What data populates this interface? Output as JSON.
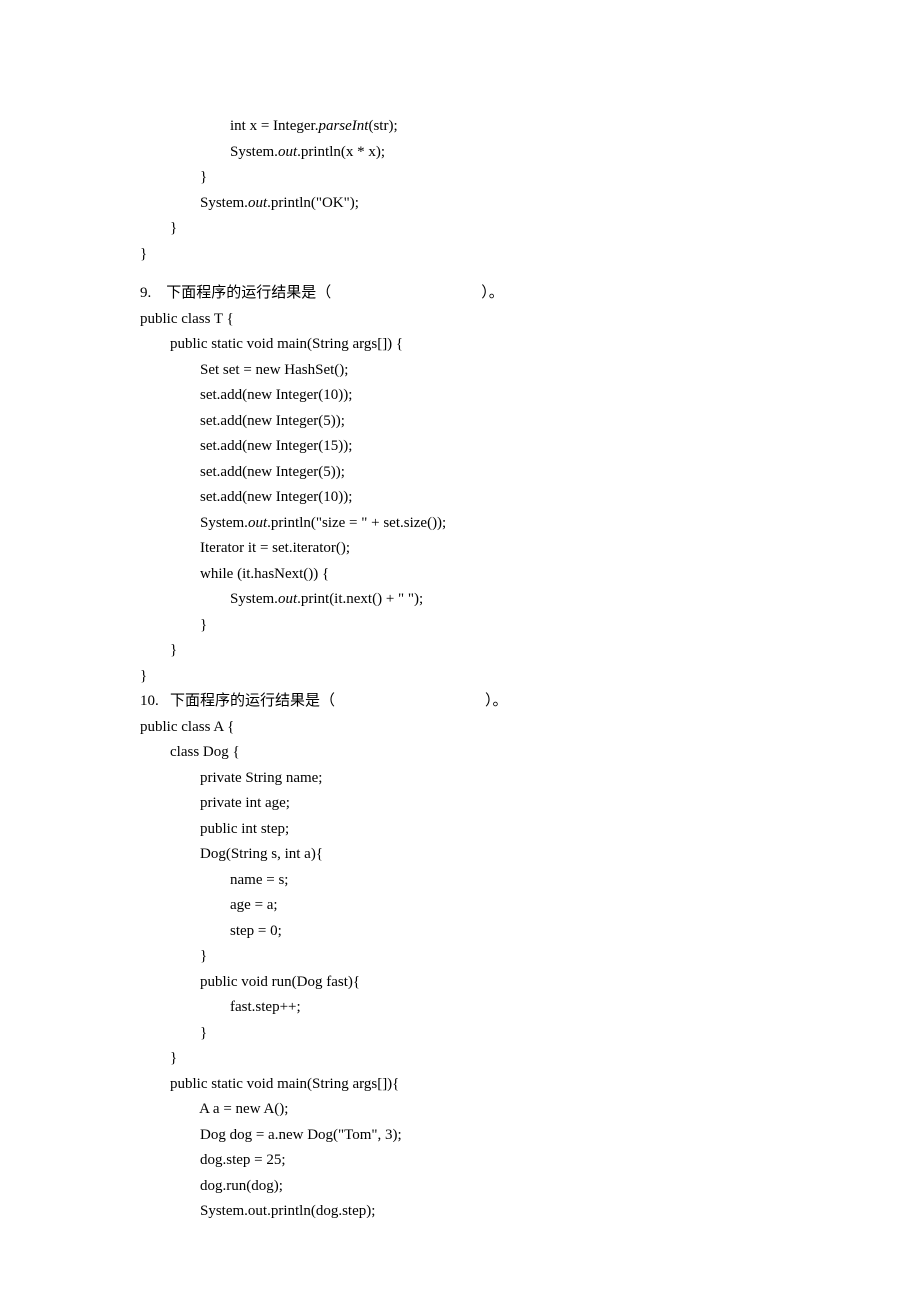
{
  "pre_code": {
    "l1": "                        int x = Integer.",
    "l1_i": "parseInt",
    "l1b": "(str);",
    "l2": "                        System.",
    "l2_i": "out",
    "l2b": ".println(x * x);",
    "l3": "                }",
    "l4": "                System.",
    "l4_i": "out",
    "l4b": ".println(\"OK\");",
    "l5": "        }",
    "l6": "}"
  },
  "q9": {
    "num": "9.",
    "text_a": "下面程序的运行结果是（",
    "text_b": "）。",
    "c1": "public class T {",
    "c2": "        public static void main(String args[]) {",
    "c3": "                Set set = new HashSet();",
    "c4": "                set.add(new Integer(10));",
    "c5": "                set.add(new Integer(5));",
    "c6": "                set.add(new Integer(15));",
    "c7": "                set.add(new Integer(5));",
    "c8": "                set.add(new Integer(10));",
    "c9a": "                System.",
    "c9i": "out",
    "c9b": ".println(\"size = \" + set.size());",
    "c10": "                Iterator it = set.iterator();",
    "c11": "                while (it.hasNext()) {",
    "c12a": "                        System.",
    "c12i": "out",
    "c12b": ".print(it.next() + \" \");",
    "c13": "                }",
    "c14": "        }",
    "c15": "}"
  },
  "q10": {
    "num": "10.",
    "text_a": "下面程序的运行结果是（",
    "text_b": "）。",
    "c1": "public class A {",
    "c2": "        class Dog {",
    "c3": "                private String name;",
    "c4": "                private int age;",
    "c5": "                public int step;",
    "c6": "                Dog(String s, int a){",
    "c7": "                        name = s;",
    "c8": "                        age = a;",
    "c9": "                        step = 0;",
    "c10": "                }",
    "c11": "                public void run(Dog fast){",
    "c12": "                        fast.step++;",
    "c13": "                }",
    "c14": "        }",
    "c15": "        public static void main(String args[]){",
    "c16": "                A a = new A();",
    "c17": "                Dog dog = a.new Dog(\"Tom\", 3);",
    "c18": "                dog.step = 25;",
    "c19": "                dog.run(dog);",
    "c20": "                System.out.println(dog.step);"
  }
}
